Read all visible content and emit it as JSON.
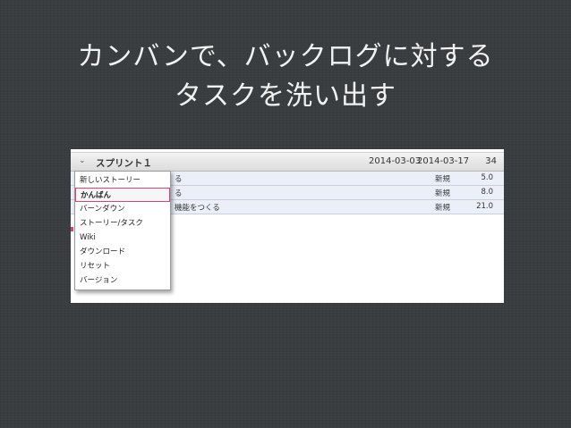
{
  "slide": {
    "title_line1": "カンバンで、バックログに対する",
    "title_line2": "タスクを洗い出す"
  },
  "sprint": {
    "chevron": "⌄",
    "name": "スプリント１",
    "start_date": "2014-03-03",
    "end_date": "2014-03-17",
    "points": "34"
  },
  "stories": [
    {
      "title": "る",
      "status": "新規",
      "points": "5.0"
    },
    {
      "title": "る",
      "status": "新規",
      "points": "8.0"
    },
    {
      "title": "機能をつくる",
      "status": "新規",
      "points": "21.0"
    }
  ],
  "menu": {
    "items": [
      {
        "label": "新しいストーリー"
      },
      {
        "label": "かんばん",
        "selected": true
      },
      {
        "label": "バーンダウン"
      },
      {
        "label": "ストーリー/タスク"
      },
      {
        "label": "Wiki"
      },
      {
        "label": "ダウンロード"
      },
      {
        "label": "リセット"
      },
      {
        "label": "バージョン"
      }
    ]
  },
  "colors": {
    "background": "#3a3d40",
    "highlight": "#d6447a",
    "row_background": "#eaeff8"
  }
}
